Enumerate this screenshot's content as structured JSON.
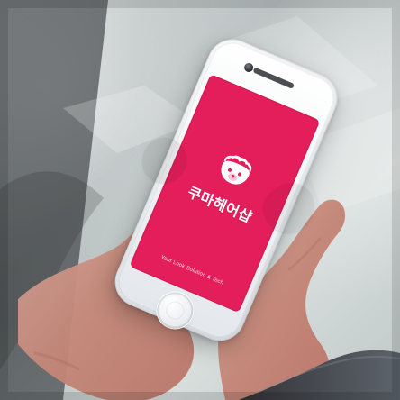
{
  "screen": {
    "app_name": "쿠마헤어샵",
    "tagline": "Your Look Solution & Tech",
    "brand_color": "#e31e5a"
  }
}
